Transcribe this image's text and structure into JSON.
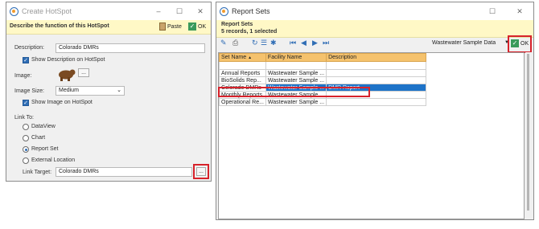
{
  "hotspot": {
    "title": "Create HotSpot",
    "header": "Describe the function of this HotSpot",
    "paste_label": "Paste",
    "ok_label": "OK",
    "description_label": "Description:",
    "description_value": "Colorado DMRs",
    "show_description_label": "Show Description on HotSpot",
    "image_label": "Image:",
    "image_size_label": "Image Size:",
    "image_size_value": "Medium",
    "show_image_label": "Show Image on HotSpot",
    "link_to_label": "Link To:",
    "link_options": [
      {
        "label": "DataView",
        "selected": false
      },
      {
        "label": "Chart",
        "selected": false
      },
      {
        "label": "Report Set",
        "selected": true
      },
      {
        "label": "External Location",
        "selected": false
      }
    ],
    "link_target_label": "Link Target:",
    "link_target_value": "Colorado DMRs",
    "browse_label": "..."
  },
  "reportsets": {
    "title": "Report Sets",
    "header_title": "Report Sets",
    "header_subtitle": "5 records, 1 selected",
    "facility_filter": "Wastewater Sample Data",
    "ok_label": "OK",
    "columns": [
      "Set Name",
      "Facility Name",
      "Description"
    ],
    "rows": [
      {
        "name": "Annual Reports",
        "facility": "Wastewater Sample ...",
        "description": "",
        "selected": false
      },
      {
        "name": "BioSolids Rep...",
        "facility": "Wastewater Sample ...",
        "description": "",
        "selected": false
      },
      {
        "name": "Colorado DMRs",
        "facility": "Wastewater Sample ...",
        "description": "DMR Report",
        "selected": true
      },
      {
        "name": "Monthly Reports",
        "facility": "Wastewater Sample ...",
        "description": "",
        "selected": false
      },
      {
        "name": "Operational Re...",
        "facility": "Wastewater Sample ...",
        "description": "",
        "selected": false
      }
    ]
  },
  "colors": {
    "accent": "#2f6db5",
    "highlight": "#d7222b",
    "header_yellow": "#fff8c6",
    "grid_header": "#f5c26d",
    "selection": "#1e73c8"
  }
}
